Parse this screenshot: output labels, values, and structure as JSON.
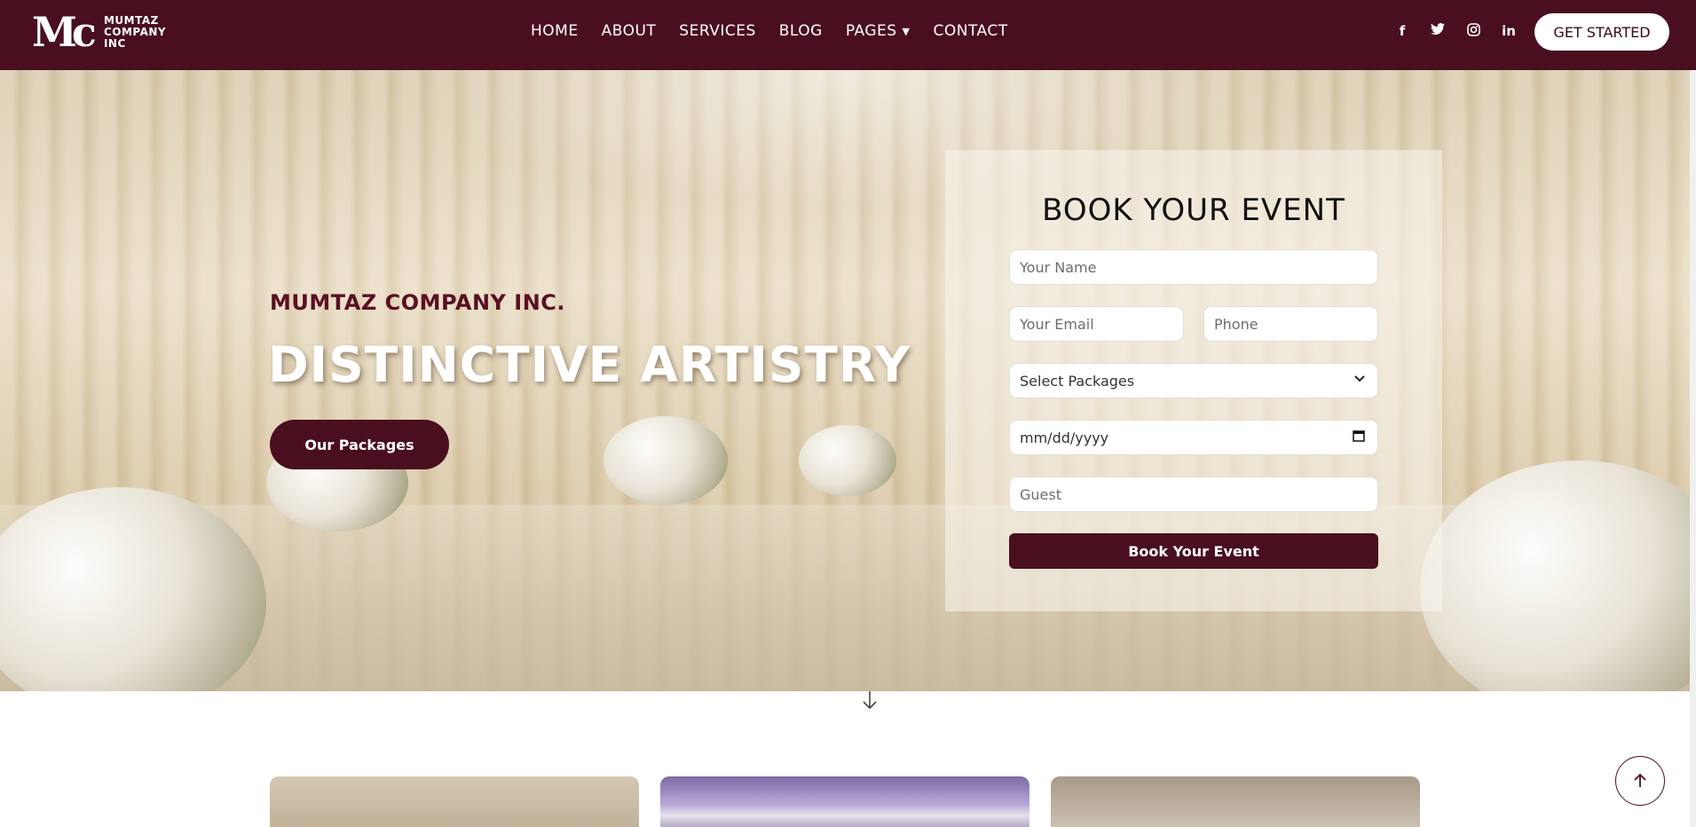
{
  "header": {
    "logo": {
      "mark": "Mc",
      "line1": "MUMTAZ",
      "line2": "COMPANY",
      "line3": "INC"
    },
    "nav": [
      "HOME",
      "ABOUT",
      "SERVICES",
      "BLOG",
      "PAGES",
      "CONTACT"
    ],
    "social": [
      {
        "name": "facebook-icon",
        "glyph": "f"
      },
      {
        "name": "twitter-icon",
        "glyph": "t"
      },
      {
        "name": "instagram-icon",
        "glyph": "◎"
      },
      {
        "name": "linkedin-icon",
        "glyph": "in"
      }
    ],
    "cta": "GET STARTED"
  },
  "hero": {
    "subtitle": "MUMTAZ COMPANY INC.",
    "title": "DISTINCTIVE ARTISTRY",
    "button": "Our Packages"
  },
  "booking": {
    "title": "BOOK YOUR EVENT",
    "name_placeholder": "Your Name",
    "email_placeholder": "Your Email",
    "phone_placeholder": "Phone",
    "package_selected": "Select Packages",
    "date_placeholder": "mm/dd/yyyy",
    "guest_placeholder": "Guest",
    "submit": "Book Your Event"
  },
  "colors": {
    "brand": "#4a0f1f",
    "white": "#ffffff"
  }
}
